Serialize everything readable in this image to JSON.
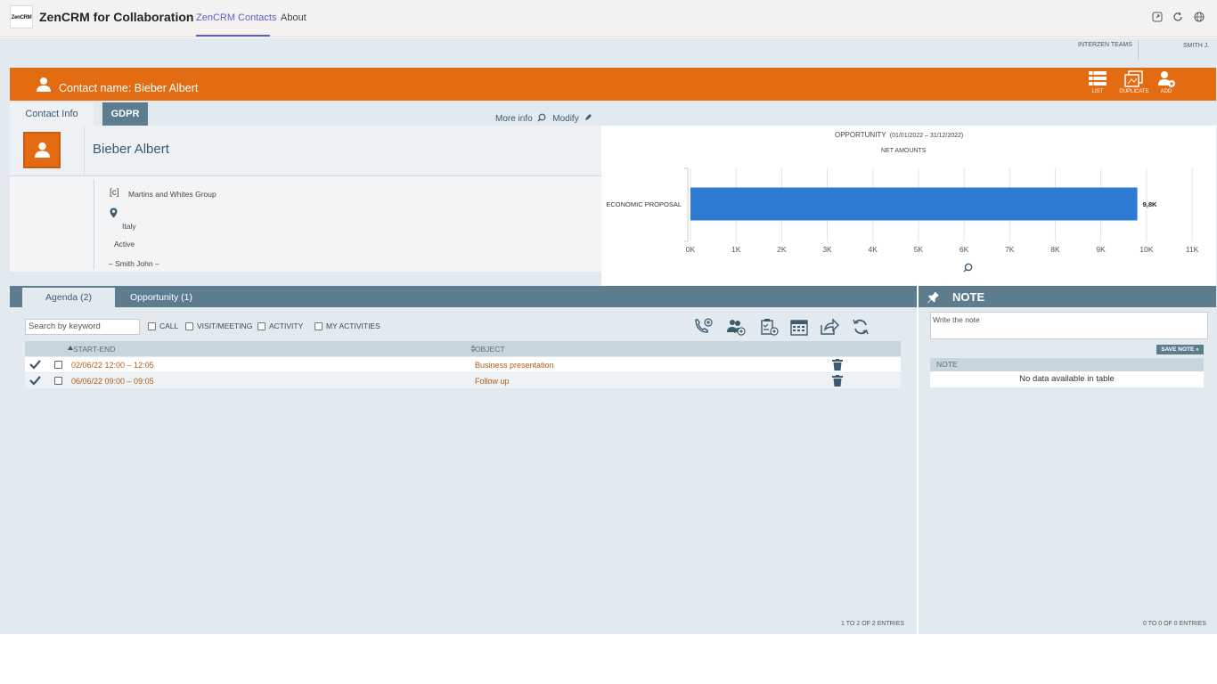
{
  "app": {
    "logo_text": "ZenCRM",
    "title": "ZenCRM for Collaboration",
    "tabs": [
      {
        "label": "ZenCRM Contacts",
        "active": true
      },
      {
        "label": "About",
        "active": false
      }
    ],
    "top_icons": [
      "popout-icon",
      "refresh-icon",
      "globe-icon"
    ]
  },
  "userbar": {
    "team": "INTERZEN TEAMS",
    "user": "SMITH J."
  },
  "header": {
    "title": "Contact name: Bieber Albert",
    "buttons": [
      {
        "label": "LIST",
        "icon": "list-icon"
      },
      {
        "label": "DUPLICATE",
        "icon": "duplicate-icon"
      },
      {
        "label": "ADD",
        "icon": "add-user-icon"
      }
    ],
    "color": "#e36c12"
  },
  "subtabs": {
    "contact_info": "Contact Info",
    "gdpr": "GDPR",
    "more_info": "More info",
    "modify": "Modify"
  },
  "contact": {
    "name": "Bieber Albert",
    "company_tag": "[c]",
    "company": "Martins and Whites Group",
    "country": "Italy",
    "status": "Active",
    "owner": "– Smith John –"
  },
  "chart_header": {
    "title": "OPPORTUNITY",
    "period": "(01/01/2022 – 31/12/2022)",
    "subtitle": "NET AMOUNTS"
  },
  "chart_data": {
    "type": "bar",
    "orientation": "horizontal",
    "title": "OPPORTUNITY",
    "subtitle": "NET AMOUNTS",
    "categories": [
      "ECONOMIC PROPOSAL"
    ],
    "values": [
      9800
    ],
    "data_labels": [
      "9,8K"
    ],
    "x_ticks": [
      "0K",
      "1K",
      "2K",
      "3K",
      "4K",
      "5K",
      "6K",
      "7K",
      "8K",
      "9K",
      "10K",
      "11K"
    ],
    "xlim": [
      0,
      11000
    ],
    "grid": true,
    "bar_color": "#2e7bd6"
  },
  "agenda": {
    "tabs": [
      {
        "label": "Agenda (2)",
        "active": true
      },
      {
        "label": "Opportunity (1)",
        "active": false
      }
    ],
    "search_placeholder": "Search by keyword",
    "filters": [
      "CALL",
      "VISIT/MEETING",
      "ACTIVITY",
      "MY ACTIVITIES"
    ],
    "toolbar_icons": [
      "add-call-icon",
      "add-meeting-icon",
      "add-activity-icon",
      "calendar-icon",
      "share-icon",
      "refresh-icon"
    ],
    "columns": [
      "START-END",
      "OBJECT"
    ],
    "rows": [
      {
        "start_end": "02/06/22 12:00 – 12:05",
        "object": "Business presentation"
      },
      {
        "start_end": "06/06/22 09:00 – 09:05",
        "object": "Follow up"
      }
    ],
    "entries": "1 TO 2 OF 2 ENTRIES"
  },
  "note": {
    "title": "NOTE",
    "placeholder": "Write the note",
    "save_label": "SAVE NOTE »",
    "column": "NOTE",
    "empty": "No data available in table",
    "entries": "0 TO 0 OF 0 ENTRIES"
  }
}
